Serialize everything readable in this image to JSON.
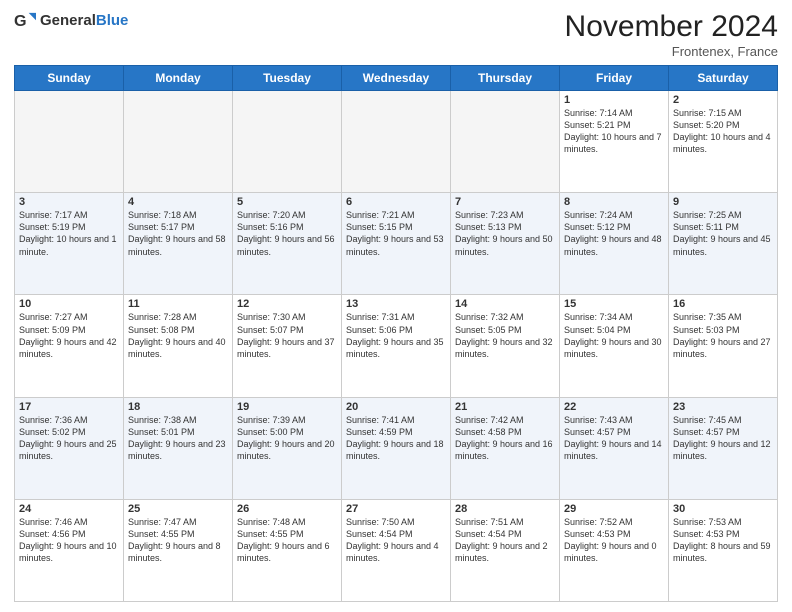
{
  "logo": {
    "text_general": "General",
    "text_blue": "Blue"
  },
  "header": {
    "month": "November 2024",
    "location": "Frontenex, France"
  },
  "weekdays": [
    "Sunday",
    "Monday",
    "Tuesday",
    "Wednesday",
    "Thursday",
    "Friday",
    "Saturday"
  ],
  "weeks": [
    [
      {
        "day": "",
        "info": ""
      },
      {
        "day": "",
        "info": ""
      },
      {
        "day": "",
        "info": ""
      },
      {
        "day": "",
        "info": ""
      },
      {
        "day": "",
        "info": ""
      },
      {
        "day": "1",
        "info": "Sunrise: 7:14 AM\nSunset: 5:21 PM\nDaylight: 10 hours and 7 minutes."
      },
      {
        "day": "2",
        "info": "Sunrise: 7:15 AM\nSunset: 5:20 PM\nDaylight: 10 hours and 4 minutes."
      }
    ],
    [
      {
        "day": "3",
        "info": "Sunrise: 7:17 AM\nSunset: 5:19 PM\nDaylight: 10 hours and 1 minute."
      },
      {
        "day": "4",
        "info": "Sunrise: 7:18 AM\nSunset: 5:17 PM\nDaylight: 9 hours and 58 minutes."
      },
      {
        "day": "5",
        "info": "Sunrise: 7:20 AM\nSunset: 5:16 PM\nDaylight: 9 hours and 56 minutes."
      },
      {
        "day": "6",
        "info": "Sunrise: 7:21 AM\nSunset: 5:15 PM\nDaylight: 9 hours and 53 minutes."
      },
      {
        "day": "7",
        "info": "Sunrise: 7:23 AM\nSunset: 5:13 PM\nDaylight: 9 hours and 50 minutes."
      },
      {
        "day": "8",
        "info": "Sunrise: 7:24 AM\nSunset: 5:12 PM\nDaylight: 9 hours and 48 minutes."
      },
      {
        "day": "9",
        "info": "Sunrise: 7:25 AM\nSunset: 5:11 PM\nDaylight: 9 hours and 45 minutes."
      }
    ],
    [
      {
        "day": "10",
        "info": "Sunrise: 7:27 AM\nSunset: 5:09 PM\nDaylight: 9 hours and 42 minutes."
      },
      {
        "day": "11",
        "info": "Sunrise: 7:28 AM\nSunset: 5:08 PM\nDaylight: 9 hours and 40 minutes."
      },
      {
        "day": "12",
        "info": "Sunrise: 7:30 AM\nSunset: 5:07 PM\nDaylight: 9 hours and 37 minutes."
      },
      {
        "day": "13",
        "info": "Sunrise: 7:31 AM\nSunset: 5:06 PM\nDaylight: 9 hours and 35 minutes."
      },
      {
        "day": "14",
        "info": "Sunrise: 7:32 AM\nSunset: 5:05 PM\nDaylight: 9 hours and 32 minutes."
      },
      {
        "day": "15",
        "info": "Sunrise: 7:34 AM\nSunset: 5:04 PM\nDaylight: 9 hours and 30 minutes."
      },
      {
        "day": "16",
        "info": "Sunrise: 7:35 AM\nSunset: 5:03 PM\nDaylight: 9 hours and 27 minutes."
      }
    ],
    [
      {
        "day": "17",
        "info": "Sunrise: 7:36 AM\nSunset: 5:02 PM\nDaylight: 9 hours and 25 minutes."
      },
      {
        "day": "18",
        "info": "Sunrise: 7:38 AM\nSunset: 5:01 PM\nDaylight: 9 hours and 23 minutes."
      },
      {
        "day": "19",
        "info": "Sunrise: 7:39 AM\nSunset: 5:00 PM\nDaylight: 9 hours and 20 minutes."
      },
      {
        "day": "20",
        "info": "Sunrise: 7:41 AM\nSunset: 4:59 PM\nDaylight: 9 hours and 18 minutes."
      },
      {
        "day": "21",
        "info": "Sunrise: 7:42 AM\nSunset: 4:58 PM\nDaylight: 9 hours and 16 minutes."
      },
      {
        "day": "22",
        "info": "Sunrise: 7:43 AM\nSunset: 4:57 PM\nDaylight: 9 hours and 14 minutes."
      },
      {
        "day": "23",
        "info": "Sunrise: 7:45 AM\nSunset: 4:57 PM\nDaylight: 9 hours and 12 minutes."
      }
    ],
    [
      {
        "day": "24",
        "info": "Sunrise: 7:46 AM\nSunset: 4:56 PM\nDaylight: 9 hours and 10 minutes."
      },
      {
        "day": "25",
        "info": "Sunrise: 7:47 AM\nSunset: 4:55 PM\nDaylight: 9 hours and 8 minutes."
      },
      {
        "day": "26",
        "info": "Sunrise: 7:48 AM\nSunset: 4:55 PM\nDaylight: 9 hours and 6 minutes."
      },
      {
        "day": "27",
        "info": "Sunrise: 7:50 AM\nSunset: 4:54 PM\nDaylight: 9 hours and 4 minutes."
      },
      {
        "day": "28",
        "info": "Sunrise: 7:51 AM\nSunset: 4:54 PM\nDaylight: 9 hours and 2 minutes."
      },
      {
        "day": "29",
        "info": "Sunrise: 7:52 AM\nSunset: 4:53 PM\nDaylight: 9 hours and 0 minutes."
      },
      {
        "day": "30",
        "info": "Sunrise: 7:53 AM\nSunset: 4:53 PM\nDaylight: 8 hours and 59 minutes."
      }
    ]
  ]
}
